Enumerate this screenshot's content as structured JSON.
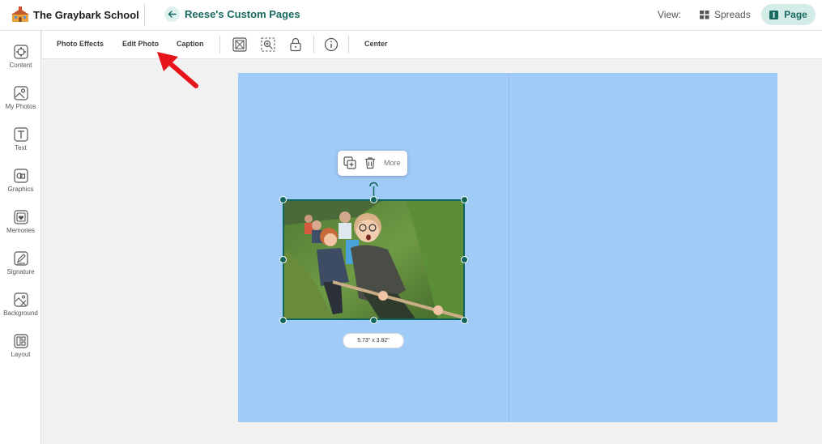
{
  "header": {
    "school_name": "The Graybark School",
    "page_name": "Reese's Custom Pages",
    "view_label": "View:",
    "spreads_label": "Spreads",
    "page_label": "Page"
  },
  "sidebar": {
    "items": [
      {
        "label": "Content",
        "icon": "content-icon"
      },
      {
        "label": "My Photos",
        "icon": "photo-icon"
      },
      {
        "label": "Text",
        "icon": "text-icon"
      },
      {
        "label": "Graphics",
        "icon": "graphics-icon"
      },
      {
        "label": "Memories",
        "icon": "memories-icon"
      },
      {
        "label": "Signature",
        "icon": "signature-icon"
      },
      {
        "label": "Background",
        "icon": "background-icon"
      },
      {
        "label": "Layout",
        "icon": "layout-icon"
      }
    ]
  },
  "toolbar": {
    "photo_effects": "Photo Effects",
    "edit_photo": "Edit Photo",
    "caption": "Caption",
    "center": "Center"
  },
  "context_menu": {
    "more": "More"
  },
  "photo": {
    "dimensions": "5.73\" x 3.82\""
  },
  "colors": {
    "brand": "#166a5f",
    "canvas": "#a1cbf7",
    "selection": "#11665c",
    "annotation_arrow": "#e8141c"
  }
}
